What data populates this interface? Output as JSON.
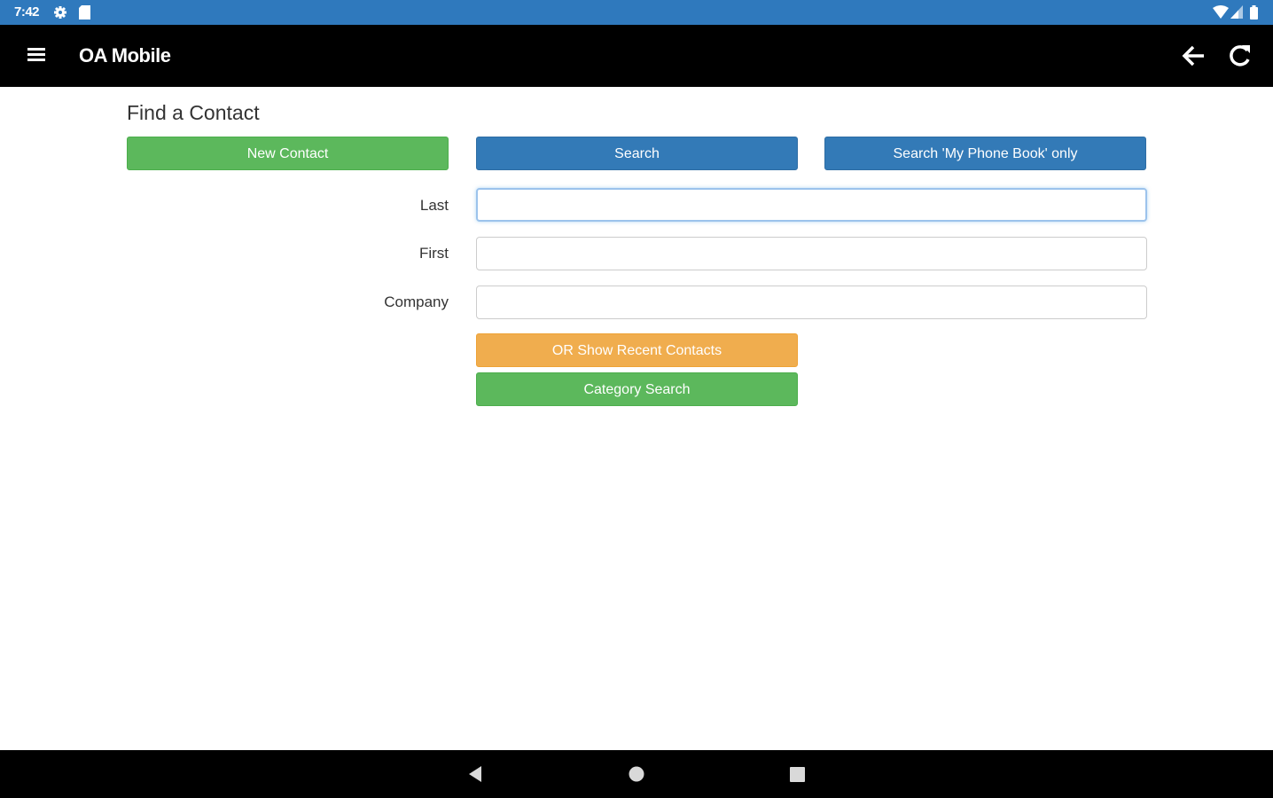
{
  "status_bar": {
    "time": "7:42",
    "icons": [
      "settings-icon",
      "sd-card-icon",
      "wifi-icon",
      "signal-icon",
      "battery-icon"
    ]
  },
  "app_bar": {
    "title": "OA Mobile",
    "icons": [
      "menu-icon",
      "back-arrow-icon",
      "refresh-icon"
    ]
  },
  "page": {
    "title": "Find a Contact"
  },
  "buttons": {
    "new_contact": "New Contact",
    "search": "Search",
    "search_phone_book": "Search 'My Phone Book' only",
    "recent_contacts": "OR Show Recent Contacts",
    "category_search": "Category Search"
  },
  "fields": {
    "last": {
      "label": "Last",
      "value": ""
    },
    "first": {
      "label": "First",
      "value": ""
    },
    "company": {
      "label": "Company",
      "value": ""
    }
  },
  "colors": {
    "status_bar": "#2f79bd",
    "app_bar": "#000000",
    "green": "#5cb85c",
    "blue": "#337ab7",
    "orange": "#f0ad4e"
  },
  "nav_bar": {
    "icons": [
      "nav-back-icon",
      "nav-home-icon",
      "nav-recent-apps-icon"
    ]
  }
}
